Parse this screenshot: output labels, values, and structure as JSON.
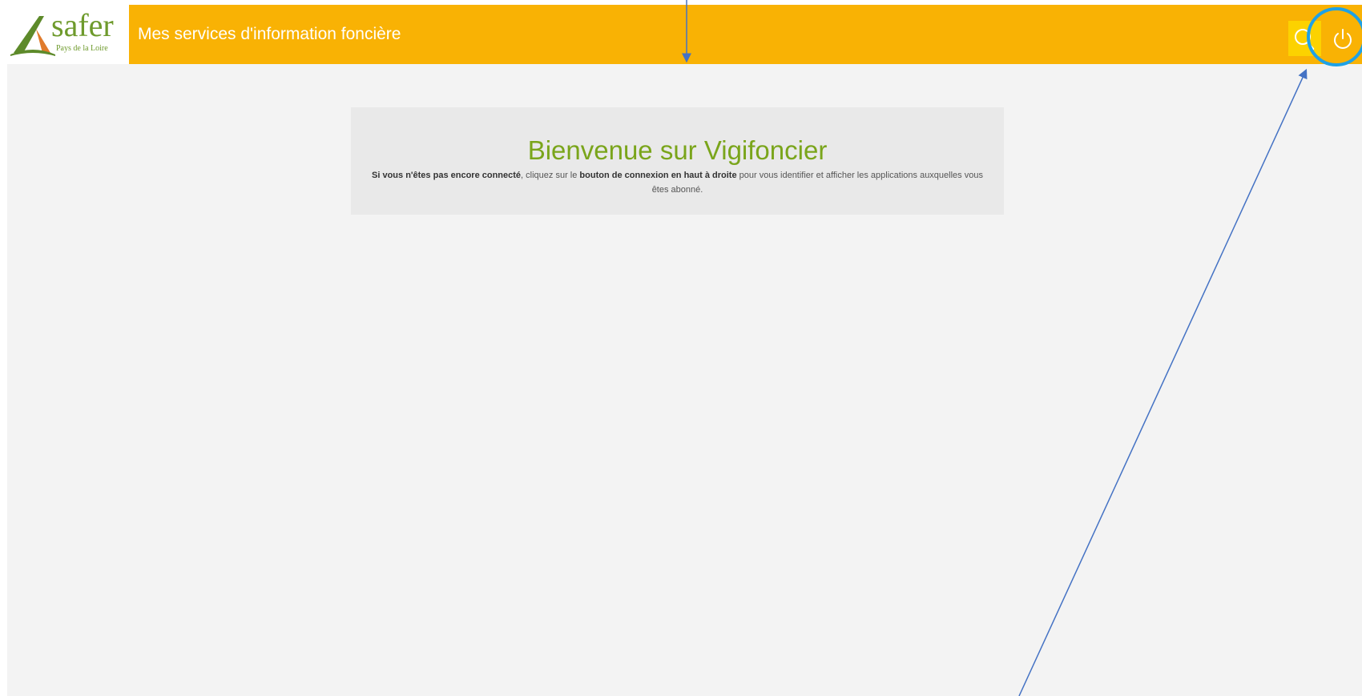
{
  "logo": {
    "word": "safer",
    "subtitle": "Pays de la Loire"
  },
  "header": {
    "title": "Mes services d'information foncière",
    "search_icon": "search-icon",
    "power_icon": "power-icon"
  },
  "welcome": {
    "title": "Bienvenue sur Vigifoncier",
    "text_strong_1": "Si vous n'êtes pas encore connecté",
    "text_1": ", cliquez sur le ",
    "text_strong_2": "bouton de connexion en haut à droite",
    "text_2": " pour vous identifier et afficher les applications auxquelles vous êtes abonné."
  },
  "colors": {
    "header": "#f9b204",
    "search_button": "#fcd200",
    "title_green": "#7aa51b",
    "logo_green": "#6e9a2c",
    "annotation_arrow": "#4472c4",
    "annotation_circle": "#1ea1e6"
  }
}
